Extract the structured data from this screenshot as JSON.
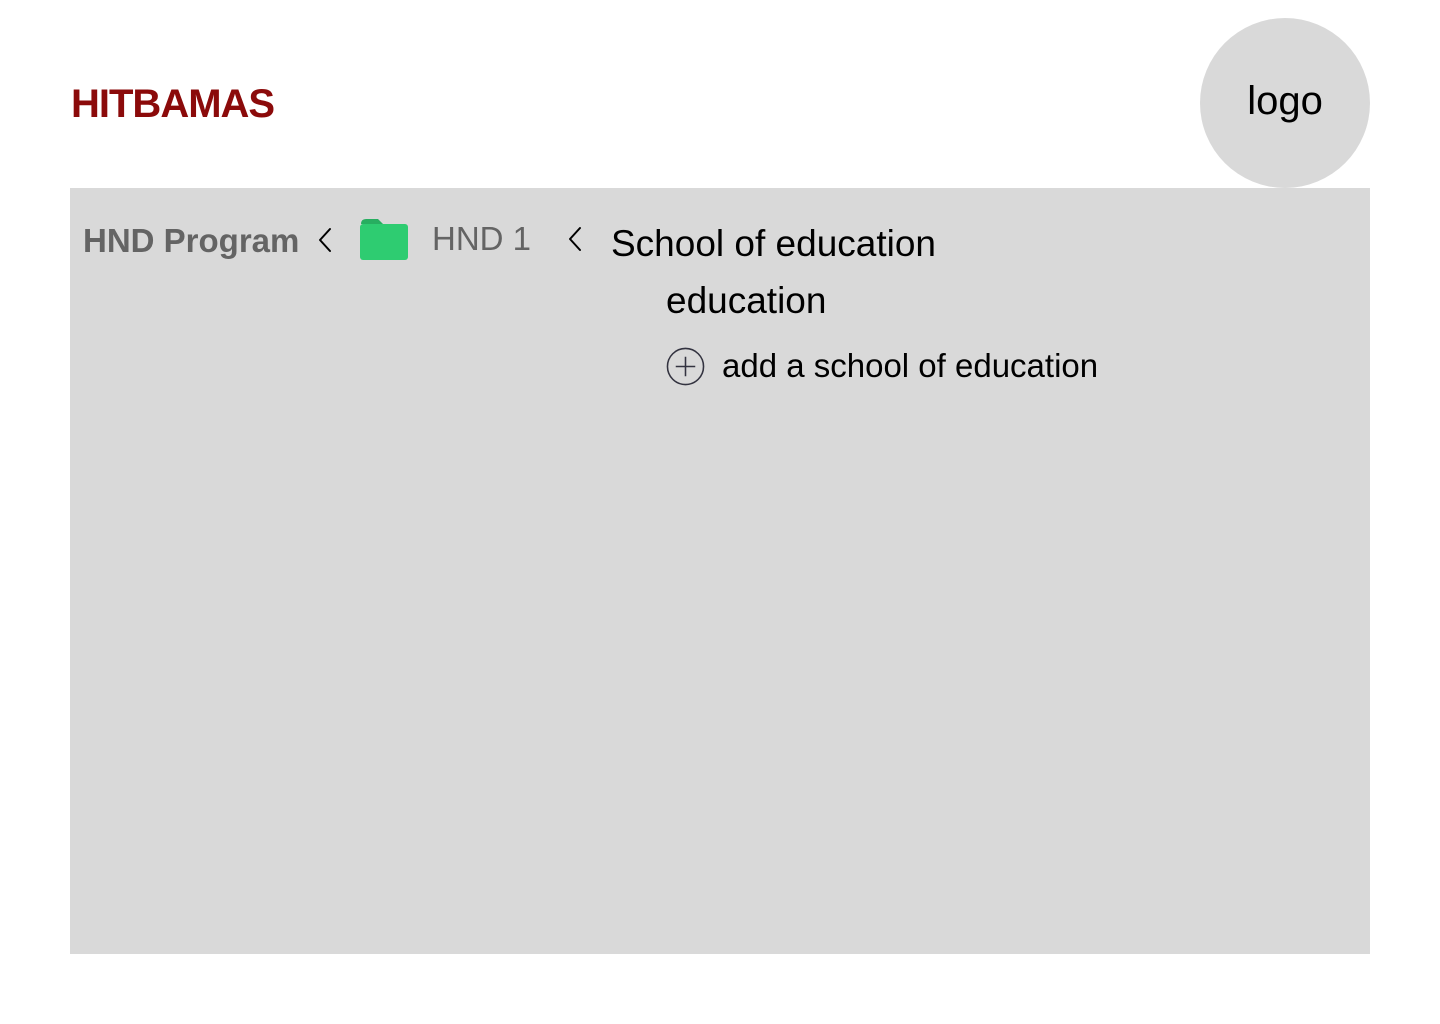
{
  "header": {
    "brand": "HITBAMAS",
    "logo_text": "logo"
  },
  "breadcrumb": {
    "items": [
      {
        "label": "HND Program"
      },
      {
        "label": "HND 1",
        "icon": "folder-icon"
      }
    ],
    "current": "School of education"
  },
  "content": {
    "items": [
      {
        "label": "education"
      }
    ],
    "add_label": "add a school of education"
  },
  "colors": {
    "brand": "#8b0a0a",
    "panel": "#d9d9d9",
    "logo_bg": "#d9d9d9",
    "breadcrumb_text": "#646464",
    "folder": "#2ecc71",
    "folder_tab": "#27ae60"
  },
  "icons": {
    "separator": "chevron-left-icon",
    "add": "plus-circle-icon",
    "folder": "folder-icon"
  }
}
